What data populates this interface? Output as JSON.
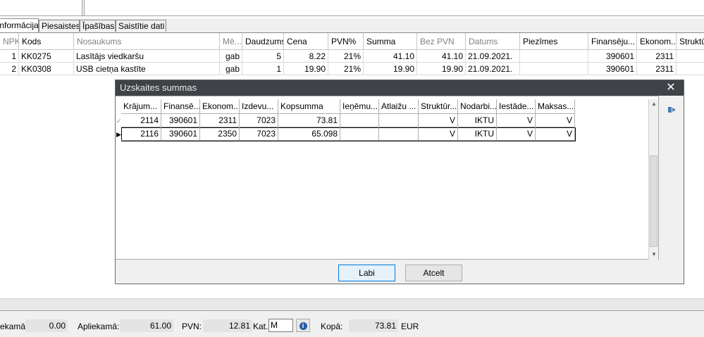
{
  "tabs": [
    {
      "label": "Informācija",
      "active": true
    },
    {
      "label": "Piesaistes",
      "active": false
    },
    {
      "label": "Īpašības",
      "active": false
    },
    {
      "label": "Saistītie dati",
      "active": false
    }
  ],
  "grid": {
    "columns": [
      "NPK",
      "Kods",
      "Nosaukums",
      "Mē...",
      "Daudzums",
      "Cena",
      "PVN%",
      "Summa",
      "Bez PVN",
      "Datums",
      "Piezīmes",
      "Finansēju...",
      "Ekonom...",
      "Struktū"
    ],
    "rows": [
      [
        "1",
        "KK0275",
        "Lasītājs viedkaršu",
        "gab",
        "5",
        "8.22",
        "21%",
        "41.10",
        "41.10",
        "21.09.2021.",
        "",
        "390601",
        "2311",
        ""
      ],
      [
        "2",
        "KK0308",
        "USB cietņa kastīte",
        "gab",
        "1",
        "19.90",
        "21%",
        "19.90",
        "19.90",
        "21.09.2021.",
        "",
        "390601",
        "2311",
        ""
      ]
    ]
  },
  "dialog": {
    "title": "Uzskaites summas",
    "columns": [
      "Krājum...",
      "Finansē...",
      "Ekonom...",
      "Izdevu...",
      "Kopsumma",
      "Ieņēmu...",
      "Atlaižu ...",
      "Struktūr...",
      "Nodarbi...",
      "Iestāde...",
      "Maksas..."
    ],
    "rows": [
      [
        "2114",
        "390601",
        "2311",
        "7023",
        "73.81",
        "",
        "",
        "V",
        "IKTU",
        "V",
        "V"
      ],
      [
        "2116",
        "390601",
        "2350",
        "7023",
        "65.098",
        "",
        "",
        "V",
        "IKTU",
        "V",
        "V"
      ]
    ],
    "ok_label": "Labi",
    "cancel_label": "Atcelt"
  },
  "footer": {
    "label1": "ekamā:",
    "value1": "0.00",
    "label2": "Apliekamā:",
    "value2": "61.00",
    "label3": "PVN:",
    "value3": "12.81",
    "label4": "Kat.",
    "kat_value": "M",
    "label5": "Kopā:",
    "value5": "73.81",
    "currency": "EUR"
  }
}
